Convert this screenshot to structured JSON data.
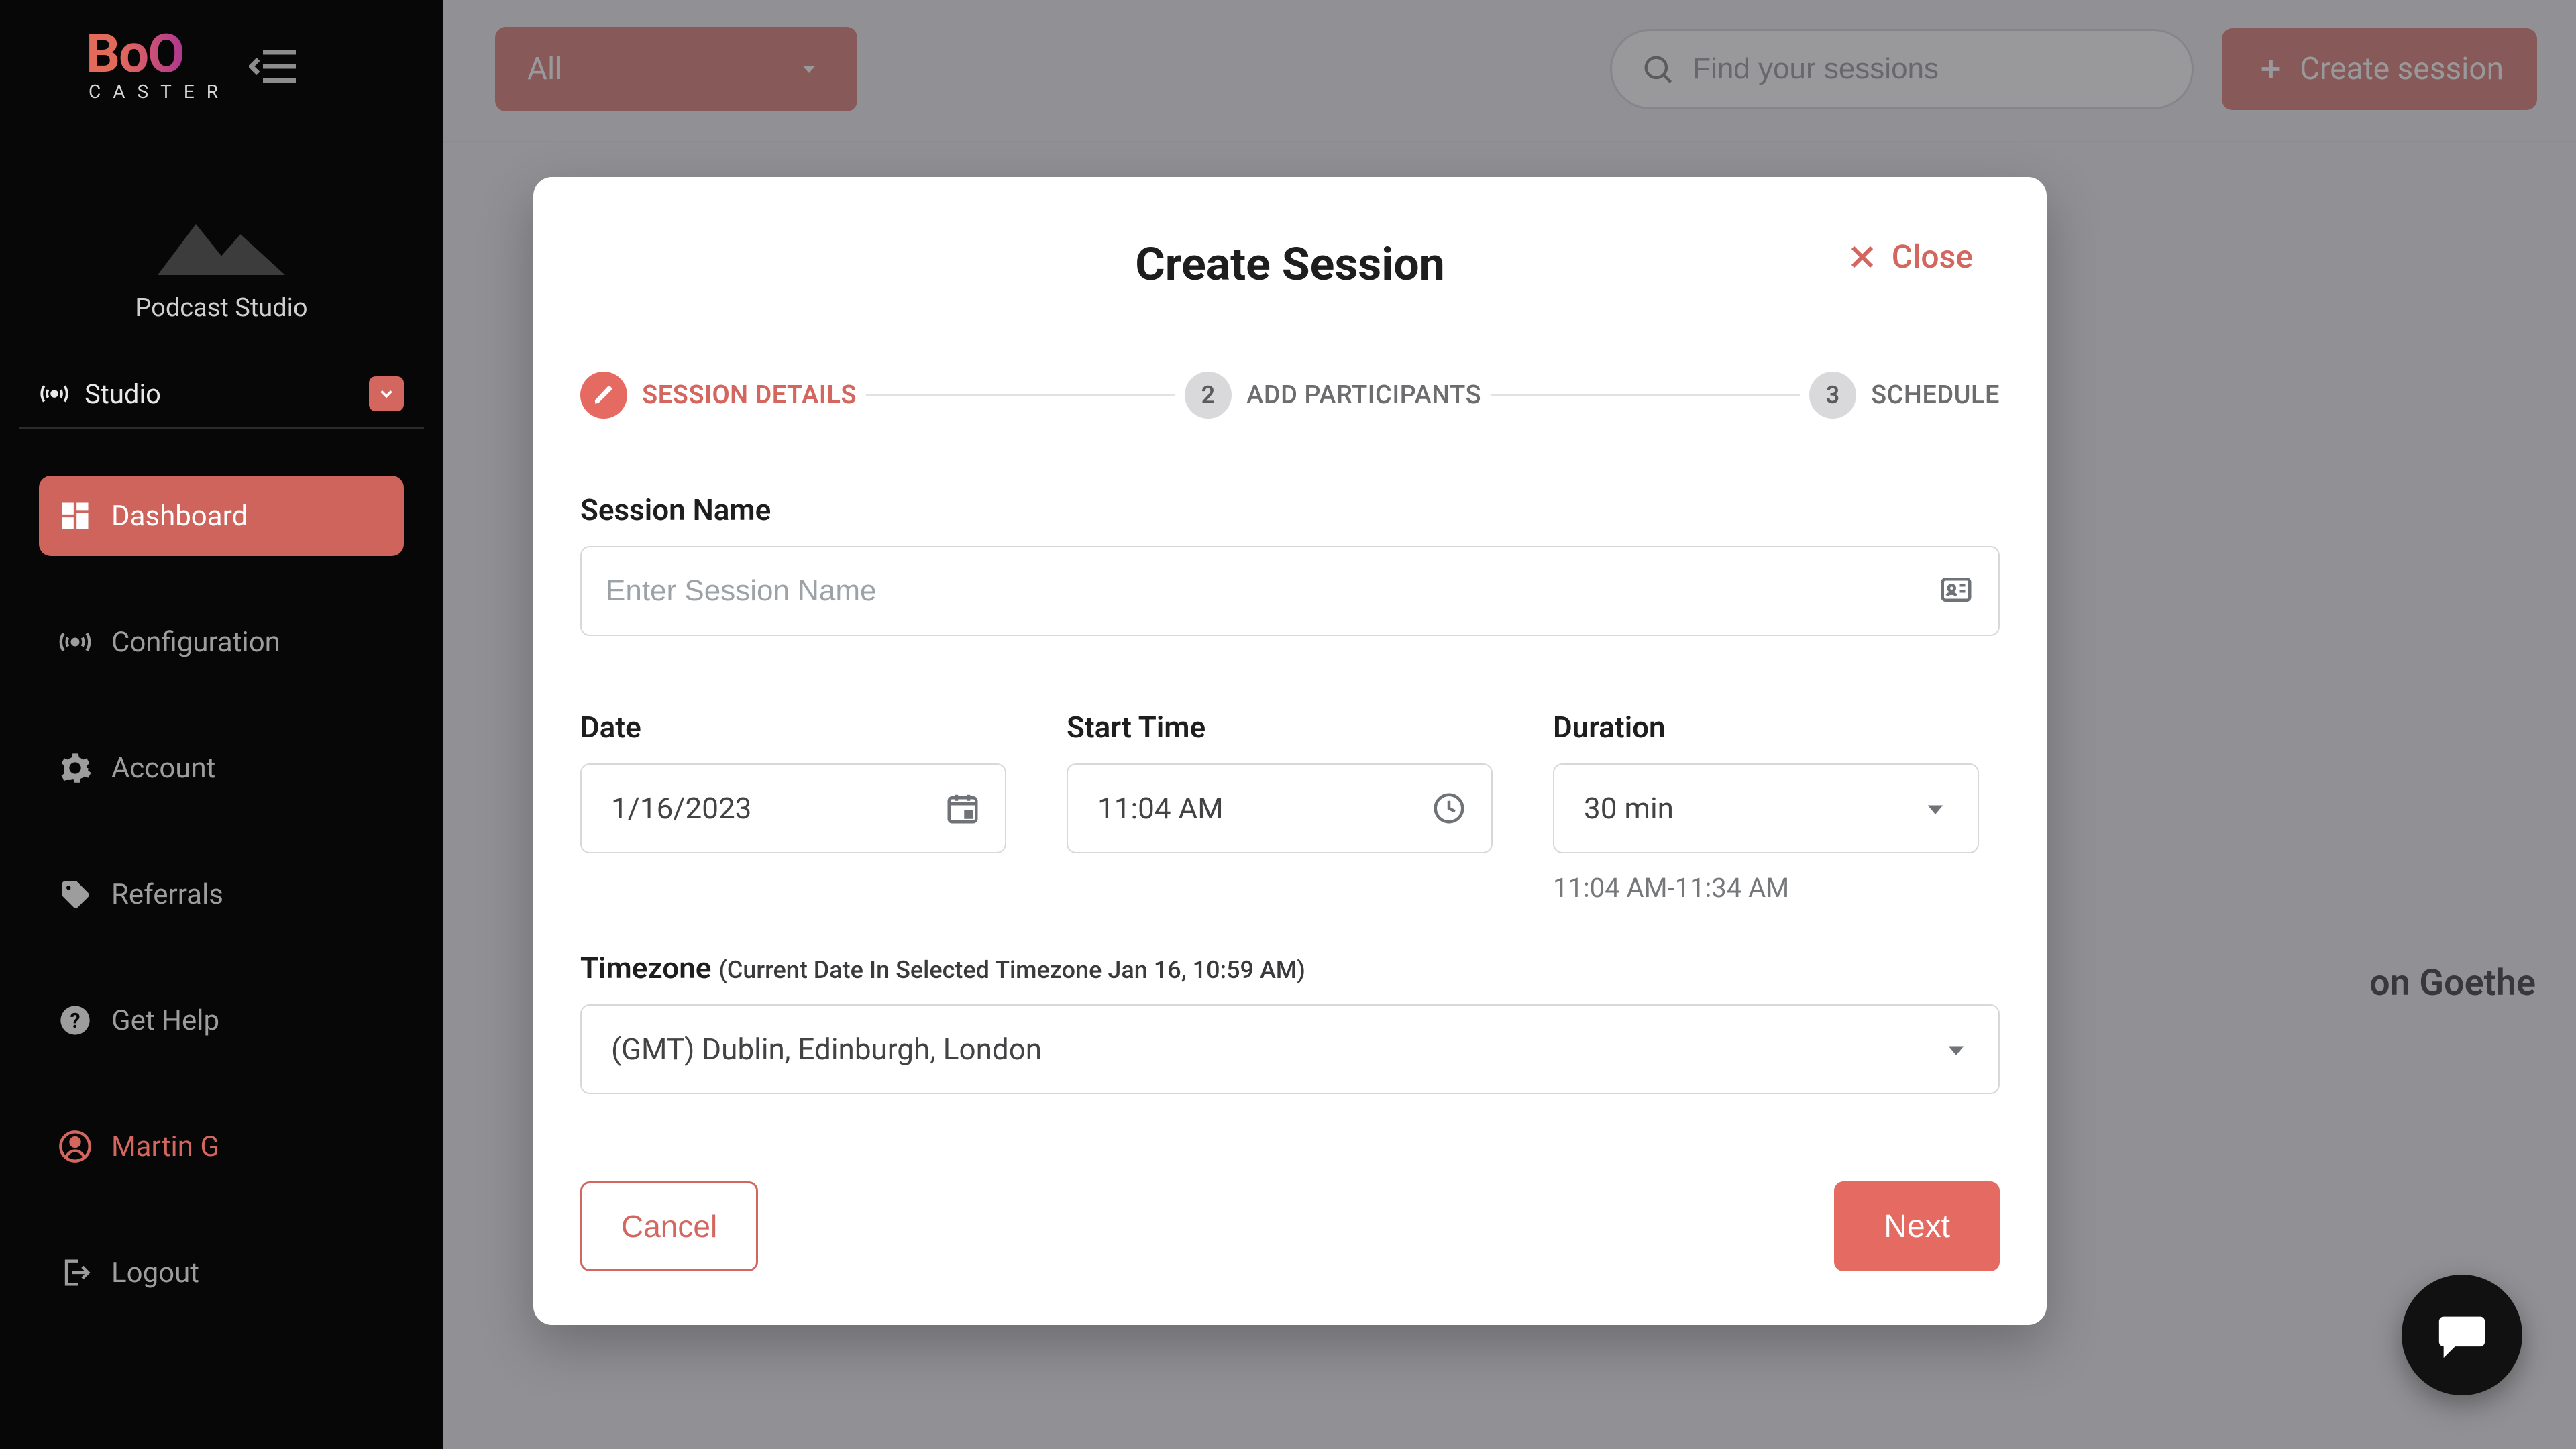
{
  "brand": {
    "top": "BoO",
    "bottom": "CASTER"
  },
  "sidebar": {
    "studio_name": "Podcast Studio",
    "studio_label": "Studio",
    "items": [
      {
        "label": "Dashboard"
      },
      {
        "label": "Configuration"
      },
      {
        "label": "Account"
      },
      {
        "label": "Referrals"
      },
      {
        "label": "Get Help"
      }
    ],
    "user": {
      "label": "Martin G"
    },
    "logout": {
      "label": "Logout"
    }
  },
  "topbar": {
    "filter_label": "All",
    "search_placeholder": "Find your sessions",
    "create_label": "Create session"
  },
  "background": {
    "partial_text": "on Goethe"
  },
  "modal": {
    "title": "Create Session",
    "close_label": "Close",
    "steps": [
      {
        "label": "SESSION DETAILS"
      },
      {
        "number": "2",
        "label": "ADD PARTICIPANTS"
      },
      {
        "number": "3",
        "label": "SCHEDULE"
      }
    ],
    "session_name": {
      "label": "Session Name",
      "placeholder": "Enter Session Name",
      "value": ""
    },
    "date": {
      "label": "Date",
      "value": "1/16/2023"
    },
    "start_time": {
      "label": "Start Time",
      "value": "11:04 AM"
    },
    "duration": {
      "label": "Duration",
      "value": "30 min",
      "range": "11:04 AM-11:34 AM"
    },
    "timezone": {
      "label": "Timezone",
      "hint": "(Current Date In Selected Timezone Jan 16, 10:59 AM)",
      "value": "(GMT) Dublin, Edinburgh, London"
    },
    "cancel": "Cancel",
    "next": "Next"
  }
}
